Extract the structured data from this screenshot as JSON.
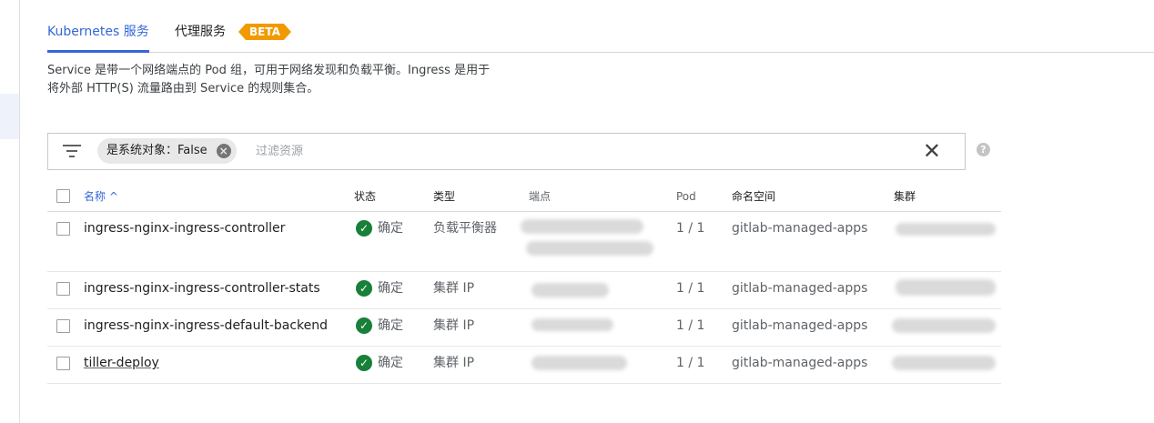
{
  "tabs": {
    "kubernetes": "Kubernetes 服务",
    "proxy": "代理服务",
    "beta": "BETA"
  },
  "description": {
    "line1": "Service 是带一个网络端点的 Pod 组，可用于网络发现和负载平衡。Ingress 是用于",
    "line2": "将外部 HTTP(S) 流量路由到 Service 的规则集合。"
  },
  "filter": {
    "chip": "是系统对象：False",
    "chip_clear": "×",
    "placeholder": "过滤资源",
    "clear": "✕",
    "help": "?"
  },
  "table": {
    "headers": {
      "name": "名称",
      "sort_arrow": "^",
      "status": "状态",
      "type": "类型",
      "endpoint": "端点",
      "pod": "Pod",
      "namespace": "命名空间",
      "cluster": "集群"
    },
    "rows": [
      {
        "name": "ingress-nginx-ingress-controller",
        "status": "确定",
        "type": "负载平衡器",
        "pod": "1 / 1",
        "namespace": "gitlab-managed-apps"
      },
      {
        "name": "ingress-nginx-ingress-controller-stats",
        "status": "确定",
        "type": "集群 IP",
        "pod": "1 / 1",
        "namespace": "gitlab-managed-apps"
      },
      {
        "name": "ingress-nginx-ingress-default-backend",
        "status": "确定",
        "type": "集群 IP",
        "pod": "1 / 1",
        "namespace": "gitlab-managed-apps"
      },
      {
        "name": "tiller-deploy",
        "status": "确定",
        "type": "集群 IP",
        "pod": "1 / 1",
        "namespace": "gitlab-managed-apps"
      }
    ]
  },
  "icons": {
    "filter": "filter-lines-icon",
    "status_ok": "check-circle-icon",
    "check": "✓"
  },
  "colors": {
    "accent": "#3367d6",
    "beta": "#f29900",
    "ok": "#188038"
  }
}
